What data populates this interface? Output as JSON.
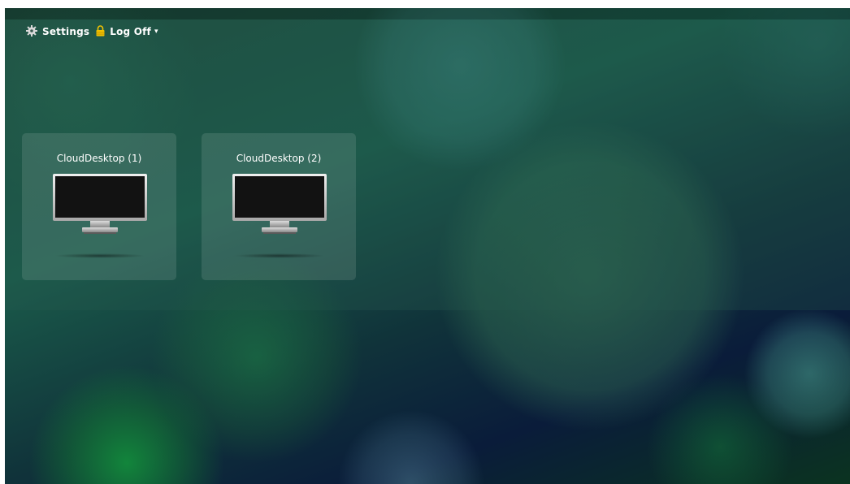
{
  "toolbar": {
    "settings_label": "Settings",
    "settings_icon": "gear-icon",
    "logoff_label": "Log Off",
    "logoff_icon": "lock-icon",
    "logoff_caret": "▾"
  },
  "desktops": [
    {
      "name": "CloudDesktop (1)",
      "icon": "monitor-icon"
    },
    {
      "name": "CloudDesktop (2)",
      "icon": "monitor-icon"
    }
  ],
  "colors": {
    "text": "#ffffff",
    "lock_icon": "#f2c200",
    "gear_icon": "#d9d9d9"
  }
}
